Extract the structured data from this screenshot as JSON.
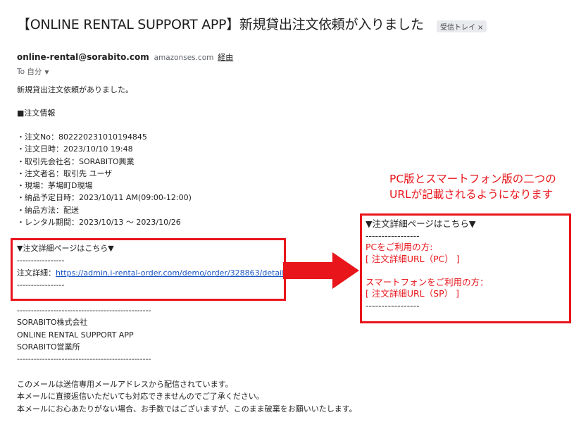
{
  "email": {
    "subject": "【ONLINE RENTAL SUPPORT APP】新規貸出注文依頼が入りました",
    "label_chip": "受信トレイ",
    "label_chip_close": "×",
    "sender_address": "online-rental@sorabito.com",
    "sender_via_domain": "amazonses.com",
    "sender_via_link": "経由",
    "to_line": "To 自分",
    "greeting": "新規貸出注文依頼がありました。",
    "order_section_title": "■注文情報",
    "order_lines": [
      "・注文No：802220231010194845",
      "・注文日時：2023/10/10 19:48",
      "・取引先会社名：SORABITO興業",
      "・注文者名：取引先 ユーザ",
      "・現場：茅場町D現場",
      "・納品予定日時：2023/10/11 AM(09:00-12:00)",
      "・納品方法：配送",
      "・レンタル期間：2023/10/13 ～ 2023/10/26"
    ],
    "detail_header": "▼注文詳細ページはこちら▼",
    "detail_separator": "-----------------",
    "detail_label": "注文詳細：",
    "detail_url": "https://admin.i-rental-order.com/demo/order/328863/detail/",
    "footer_separator": "------------------------------------------------",
    "company_lines": [
      "SORABITO株式会社",
      "ONLINE RENTAL SUPPORT APP",
      "SORABITO営業所"
    ],
    "notice_lines": [
      "このメールは送信専用メールアドレスから配信されています。",
      "本メールに直接返信いただいても対応できませんのでご了承ください。",
      "本メールにお心あたりがない場合、お手数ではございますが、このまま破棄をお願いいたします。"
    ]
  },
  "annotation": {
    "callout_lines": [
      "PC版とスマートフォン版の二つの",
      "URLが記載されるようになります"
    ],
    "new_header": "▼注文詳細ページはこちら▼",
    "new_separator": "-----------------",
    "pc_label": "PCをご利用の方:",
    "pc_url_placeholder": "[ 注文詳細URL（PC） ]",
    "sp_label": "スマートフォンをご利用の方：",
    "sp_url_placeholder": "[ 注文詳細URL（SP） ]",
    "accent_color": "#e8151b"
  }
}
